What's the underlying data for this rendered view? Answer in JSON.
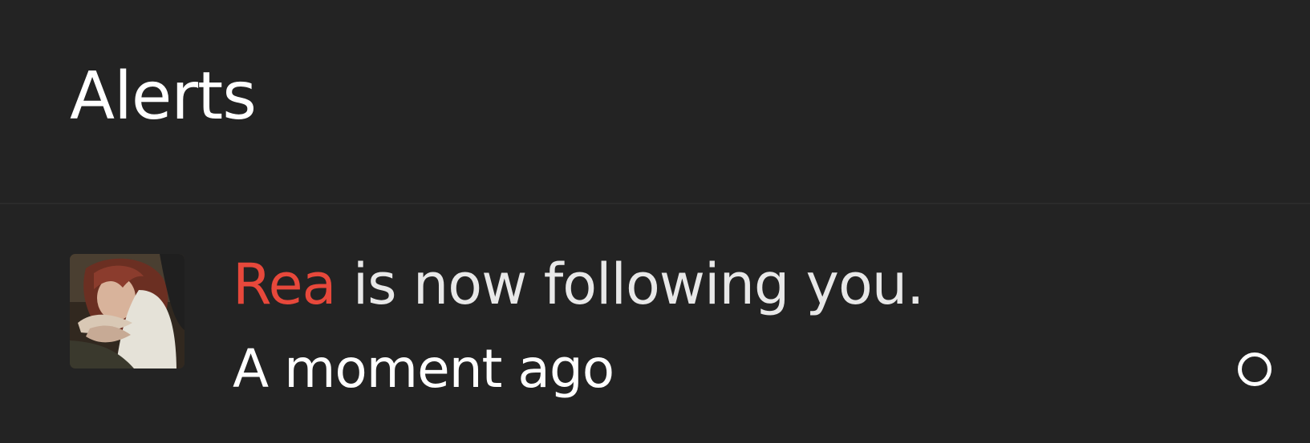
{
  "header": {
    "title": "Alerts"
  },
  "alerts": [
    {
      "username": "Rea",
      "message": " is now following you.",
      "timestamp": "A moment ago",
      "read_indicator_icon": "circle-outline-icon"
    }
  ],
  "colors": {
    "background": "#232323",
    "username": "#e7483b",
    "text": "#e8e8e8"
  }
}
